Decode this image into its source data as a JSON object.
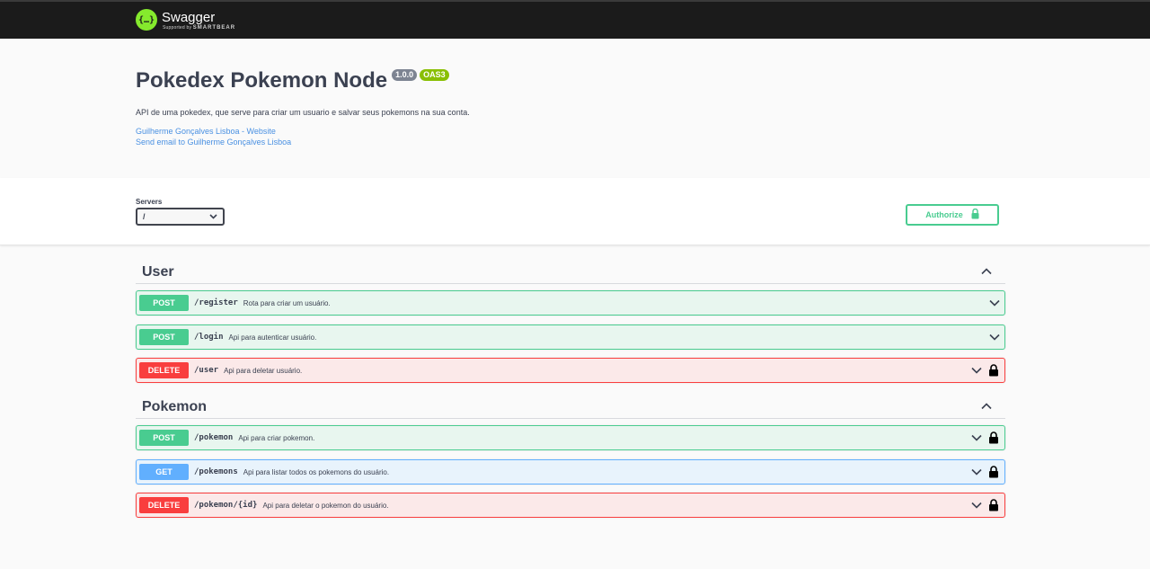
{
  "topbar": {
    "logo_glyph": "{…}",
    "brand": "Swagger",
    "supported_by": "Supported by",
    "supported_company": "SMARTBEAR"
  },
  "info": {
    "title": "Pokedex Pokemon Node",
    "version": "1.0.0",
    "oas": "OAS3",
    "description": "API de uma pokedex, que serve para criar um usuario e salvar seus pokemons na sua conta.",
    "website_link": "Guilherme Gonçalves Lisboa - Website",
    "email_link": "Send email to Guilherme Gonçalves Lisboa"
  },
  "servers": {
    "label": "Servers",
    "selected": "/"
  },
  "authorize": {
    "label": "Authorize"
  },
  "sections": [
    {
      "name": "User",
      "operations": [
        {
          "method": "POST",
          "path": "/register",
          "summary": "Rota para criar um usuário.",
          "locked": false
        },
        {
          "method": "POST",
          "path": "/login",
          "summary": "Api para autenticar usuário.",
          "locked": false
        },
        {
          "method": "DELETE",
          "path": "/user",
          "summary": "Api para deletar usuário.",
          "locked": true
        }
      ]
    },
    {
      "name": "Pokemon",
      "operations": [
        {
          "method": "POST",
          "path": "/pokemon",
          "summary": "Api para criar pokemon.",
          "locked": true
        },
        {
          "method": "GET",
          "path": "/pokemons",
          "summary": "Api para listar todos os pokemons do usuário.",
          "locked": true
        },
        {
          "method": "DELETE",
          "path": "/pokemon/{id}",
          "summary": "Api para deletar o pokemon do usuário.",
          "locked": true
        }
      ]
    }
  ],
  "colors": {
    "post": "#49cc90",
    "get": "#61affe",
    "delete": "#f93e3e",
    "topbar": "#1b1b1b",
    "logo": "#85ea2d"
  },
  "icons": {
    "expand": "chevron-down-icon",
    "collapse": "chevron-up-icon",
    "lock": "lock-icon"
  }
}
